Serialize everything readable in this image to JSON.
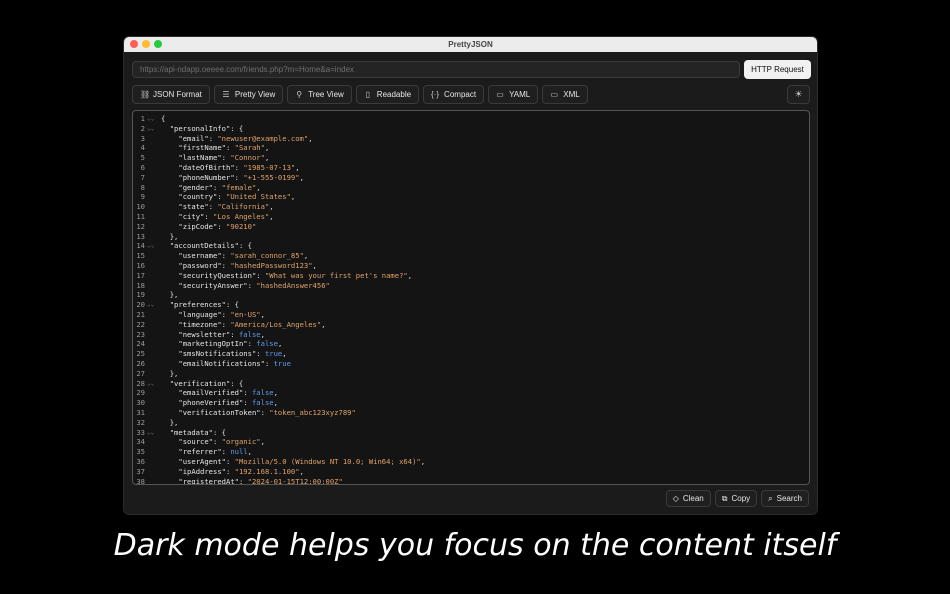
{
  "window": {
    "title": "PrettyJSON"
  },
  "url": {
    "placeholder": "https://api-ndapp.oeeee.com/friends.php?m=Home&a=index"
  },
  "http_button": "HTTP Request",
  "toolbar": [
    {
      "label": "JSON Format",
      "icon": "link-icon"
    },
    {
      "label": "Pretty View",
      "icon": "list-icon"
    },
    {
      "label": "Tree View",
      "icon": "tree-icon"
    },
    {
      "label": "Readable",
      "icon": "book-icon"
    },
    {
      "label": "Compact",
      "icon": "braces-icon"
    },
    {
      "label": "YAML",
      "icon": "file-icon"
    },
    {
      "label": "XML",
      "icon": "file-icon"
    }
  ],
  "theme_toggle_icon": "sun-icon",
  "bottom_buttons": [
    {
      "label": "Clean",
      "icon": "eraser-icon"
    },
    {
      "label": "Copy",
      "icon": "copy-icon"
    },
    {
      "label": "Search",
      "icon": "search-icon"
    }
  ],
  "colors": {
    "string": "#e0a36b",
    "bool": "#5d9cec",
    "background": "#141414"
  },
  "code_lines": [
    {
      "n": "1",
      "fold": true,
      "indent": 0,
      "text": "{"
    },
    {
      "n": "2",
      "fold": true,
      "indent": 1,
      "key": "\"personalInfo\"",
      "text": ": {"
    },
    {
      "n": "3",
      "indent": 2,
      "key": "\"email\"",
      "val": "\"newuser@example.com\"",
      "type": "s",
      "tail": ","
    },
    {
      "n": "4",
      "indent": 2,
      "key": "\"firstName\"",
      "val": "\"Sarah\"",
      "type": "s",
      "tail": ","
    },
    {
      "n": "5",
      "indent": 2,
      "key": "\"lastName\"",
      "val": "\"Connor\"",
      "type": "s",
      "tail": ","
    },
    {
      "n": "6",
      "indent": 2,
      "key": "\"dateOfBirth\"",
      "val": "\"1985-07-13\"",
      "type": "s",
      "tail": ","
    },
    {
      "n": "7",
      "indent": 2,
      "key": "\"phoneNumber\"",
      "val": "\"+1-555-0199\"",
      "type": "s",
      "tail": ","
    },
    {
      "n": "8",
      "indent": 2,
      "key": "\"gender\"",
      "val": "\"female\"",
      "type": "s",
      "tail": ","
    },
    {
      "n": "9",
      "indent": 2,
      "key": "\"country\"",
      "val": "\"United States\"",
      "type": "s",
      "tail": ","
    },
    {
      "n": "10",
      "indent": 2,
      "key": "\"state\"",
      "val": "\"California\"",
      "type": "s",
      "tail": ","
    },
    {
      "n": "11",
      "indent": 2,
      "key": "\"city\"",
      "val": "\"Los Angeles\"",
      "type": "s",
      "tail": ","
    },
    {
      "n": "12",
      "indent": 2,
      "key": "\"zipCode\"",
      "val": "\"90210\"",
      "type": "s",
      "tail": ""
    },
    {
      "n": "13",
      "indent": 1,
      "text": "},"
    },
    {
      "n": "14",
      "fold": true,
      "indent": 1,
      "key": "\"accountDetails\"",
      "text": ": {"
    },
    {
      "n": "15",
      "indent": 2,
      "key": "\"username\"",
      "val": "\"sarah_connor_85\"",
      "type": "s",
      "tail": ","
    },
    {
      "n": "16",
      "indent": 2,
      "key": "\"password\"",
      "val": "\"hashedPassword123\"",
      "type": "s",
      "tail": ","
    },
    {
      "n": "17",
      "indent": 2,
      "key": "\"securityQuestion\"",
      "val": "\"What was your first pet's name?\"",
      "type": "s",
      "tail": ","
    },
    {
      "n": "18",
      "indent": 2,
      "key": "\"securityAnswer\"",
      "val": "\"hashedAnswer456\"",
      "type": "s",
      "tail": ""
    },
    {
      "n": "19",
      "indent": 1,
      "text": "},"
    },
    {
      "n": "20",
      "fold": true,
      "indent": 1,
      "key": "\"preferences\"",
      "text": ": {"
    },
    {
      "n": "21",
      "indent": 2,
      "key": "\"language\"",
      "val": "\"en-US\"",
      "type": "s",
      "tail": ","
    },
    {
      "n": "22",
      "indent": 2,
      "key": "\"timezone\"",
      "val": "\"America/Los_Angeles\"",
      "type": "s",
      "tail": ","
    },
    {
      "n": "23",
      "indent": 2,
      "key": "\"newsletter\"",
      "val": "false",
      "type": "b",
      "tail": ","
    },
    {
      "n": "24",
      "indent": 2,
      "key": "\"marketingOptIn\"",
      "val": "false",
      "type": "b",
      "tail": ","
    },
    {
      "n": "25",
      "indent": 2,
      "key": "\"smsNotifications\"",
      "val": "true",
      "type": "b",
      "tail": ","
    },
    {
      "n": "26",
      "indent": 2,
      "key": "\"emailNotifications\"",
      "val": "true",
      "type": "b",
      "tail": ""
    },
    {
      "n": "27",
      "indent": 1,
      "text": "},"
    },
    {
      "n": "28",
      "fold": true,
      "indent": 1,
      "key": "\"verification\"",
      "text": ": {"
    },
    {
      "n": "29",
      "indent": 2,
      "key": "\"emailVerified\"",
      "val": "false",
      "type": "b",
      "tail": ","
    },
    {
      "n": "30",
      "indent": 2,
      "key": "\"phoneVerified\"",
      "val": "false",
      "type": "b",
      "tail": ","
    },
    {
      "n": "31",
      "indent": 2,
      "key": "\"verificationToken\"",
      "val": "\"token_abc123xyz789\"",
      "type": "s",
      "tail": ""
    },
    {
      "n": "32",
      "indent": 1,
      "text": "},"
    },
    {
      "n": "33",
      "fold": true,
      "indent": 1,
      "key": "\"metadata\"",
      "text": ": {"
    },
    {
      "n": "34",
      "indent": 2,
      "key": "\"source\"",
      "val": "\"organic\"",
      "type": "s",
      "tail": ","
    },
    {
      "n": "35",
      "indent": 2,
      "key": "\"referrer\"",
      "val": "null",
      "type": "b",
      "tail": ","
    },
    {
      "n": "36",
      "indent": 2,
      "key": "\"userAgent\"",
      "val": "\"Mozilla/5.0 (Windows NT 10.0; Win64; x64)\"",
      "type": "s",
      "tail": ","
    },
    {
      "n": "37",
      "indent": 2,
      "key": "\"ipAddress\"",
      "val": "\"192.168.1.100\"",
      "type": "s",
      "tail": ","
    },
    {
      "n": "38",
      "indent": 2,
      "key": "\"registeredAt\"",
      "val": "\"2024-01-15T12:00:00Z\"",
      "type": "s",
      "tail": ""
    }
  ],
  "caption": "Dark mode helps you focus on the content itself"
}
